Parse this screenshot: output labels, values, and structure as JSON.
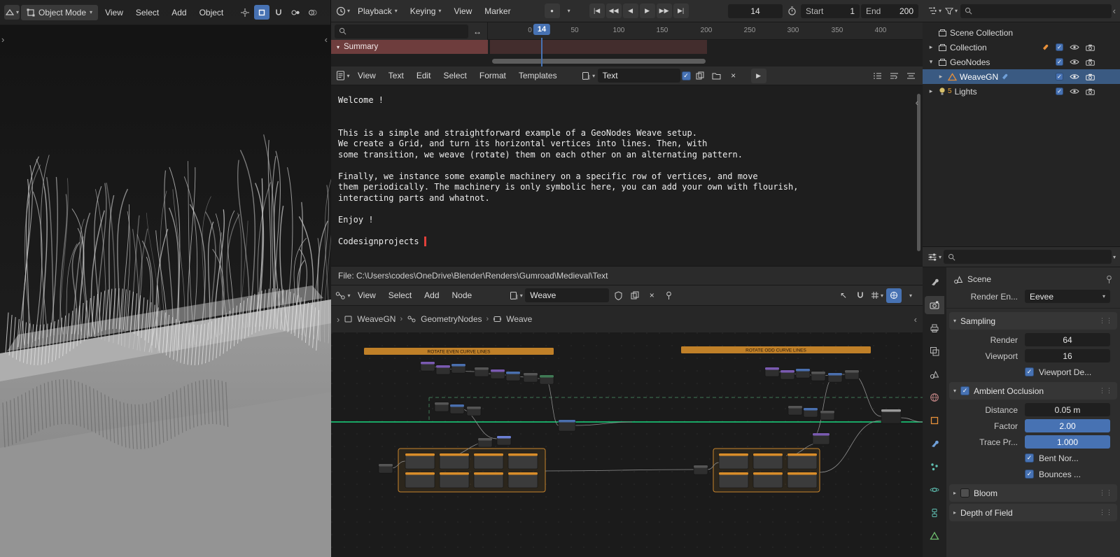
{
  "colors": {
    "accent_blue": "#4772b3",
    "selection_blue": "#3a5a82",
    "frame_orange": "#c8852c",
    "summary_red": "#6e3d3d",
    "wire_green": "#19d67e",
    "cursor_red": "#e0403a"
  },
  "viewport": {
    "mode": "Object Mode",
    "menus": [
      "View",
      "Select",
      "Add",
      "Object"
    ]
  },
  "timeline": {
    "menus": [
      "Playback",
      "Keying",
      "View",
      "Marker"
    ],
    "frame_field": "14",
    "playhead": "14",
    "start_label": "Start",
    "start_value": "1",
    "end_label": "End",
    "end_value": "200",
    "ticks": [
      "0",
      "50",
      "100",
      "150",
      "200",
      "250",
      "300",
      "350",
      "400"
    ],
    "channel": "Summary"
  },
  "text_editor": {
    "menus": [
      "View",
      "Text",
      "Edit",
      "Select",
      "Format",
      "Templates"
    ],
    "datablock": "Text",
    "body": "Welcome !\n\n\nThis is a simple and straightforward example of a GeoNodes Weave setup.\nWe create a Grid, and turn its horizontal vertices into lines. Then, with\nsome transition, we weave (rotate) them on each other on an alternating pattern.\n\nFinally, we instance some example machinery on a specific row of vertices, and move\nthem periodically. The machinery is only symbolic here, you can add your own with flourish,\ninteracting parts and whatnot.\n\nEnjoy !\n\nCodesignprojects ",
    "file_path": "File: C:\\Users\\codes\\OneDrive\\Blender\\Renders\\Gumroad\\Medieval\\Text"
  },
  "node_editor": {
    "menus": [
      "View",
      "Select",
      "Add",
      "Node"
    ],
    "name": "Weave",
    "breadcrumb": [
      "WeaveGN",
      "GeometryNodes",
      "Weave"
    ],
    "frame_even": "ROTATE EVEN CURVE LINES",
    "frame_odd": "ROTATE ODD CURVE LINES"
  },
  "outliner": {
    "items": [
      {
        "label": "Scene Collection"
      },
      {
        "label": "Collection"
      },
      {
        "label": "GeoNodes"
      },
      {
        "label": "WeaveGN"
      },
      {
        "label": "Lights",
        "count": "5"
      }
    ]
  },
  "properties": {
    "context": "Scene",
    "render_engine_label": "Render En...",
    "render_engine": "Eevee",
    "sampling": {
      "title": "Sampling",
      "render_label": "Render",
      "render_value": "64",
      "viewport_label": "Viewport",
      "viewport_value": "16",
      "denoise_label": "Viewport De..."
    },
    "ao": {
      "title": "Ambient Occlusion",
      "distance_label": "Distance",
      "distance_value": "0.05 m",
      "factor_label": "Factor",
      "factor_value": "2.00",
      "trace_label": "Trace Pr...",
      "trace_value": "1.000",
      "bent_label": "Bent Nor...",
      "bounces_label": "Bounces ..."
    },
    "bloom": "Bloom",
    "dof": "Depth of Field"
  }
}
